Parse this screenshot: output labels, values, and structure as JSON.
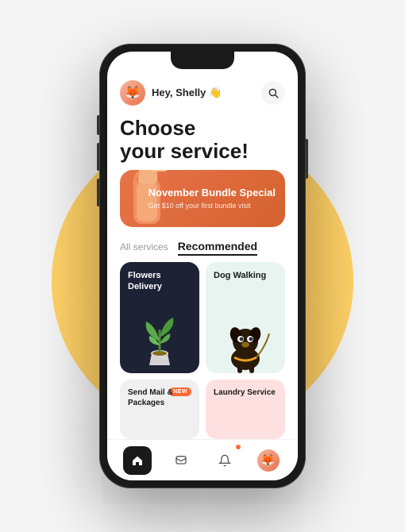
{
  "background": {
    "circle_color": "#FFD166"
  },
  "header": {
    "greeting": "Hey, Shelly 👋",
    "avatar_emoji": "🦊",
    "search_label": "search"
  },
  "hero": {
    "line1": "Choose",
    "line2": "your service!"
  },
  "promo": {
    "title": "November\nBundle Special",
    "subtitle": "Get $10 off your first\nbundle visit",
    "bg_color": "#E8734A"
  },
  "tabs": [
    {
      "id": "all",
      "label": "All services",
      "active": false
    },
    {
      "id": "recommended",
      "label": "Recommended",
      "active": true
    }
  ],
  "services": [
    {
      "id": "flowers",
      "label": "Flowers\nDelivery",
      "theme": "dark",
      "new": false
    },
    {
      "id": "dog",
      "label": "Dog\nWalking",
      "theme": "light-green",
      "new": false
    },
    {
      "id": "mail",
      "label": "Send Mail\n& Packages",
      "theme": "light-gray",
      "new": true
    },
    {
      "id": "laundry",
      "label": "Laundry\nService",
      "theme": "light-pink",
      "new": false
    }
  ],
  "new_badge_label": "NEW",
  "nav": {
    "items": [
      {
        "id": "home",
        "icon": "🏠",
        "active": true
      },
      {
        "id": "messages",
        "icon": "💬",
        "active": false
      },
      {
        "id": "notifications",
        "icon": "🔔",
        "active": false
      },
      {
        "id": "profile",
        "icon": "👤",
        "active": false
      }
    ]
  }
}
